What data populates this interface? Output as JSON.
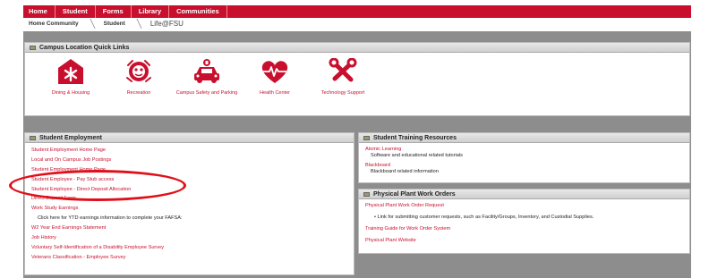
{
  "nav": {
    "items": [
      "Home",
      "Student",
      "Forms",
      "Library",
      "Communities"
    ]
  },
  "breadcrumb": {
    "items": [
      "Home Community",
      "Student"
    ],
    "current": "Life@FSU"
  },
  "quick_links": {
    "title": "Campus Location Quick Links",
    "items": [
      {
        "label": "Dining & Housing",
        "icon": "dining-housing-icon"
      },
      {
        "label": "Recreation",
        "icon": "recreation-icon"
      },
      {
        "label": "Campus Safety and Parking",
        "icon": "campus-safety-icon"
      },
      {
        "label": "Health Center",
        "icon": "health-center-icon"
      },
      {
        "label": "Technology Support",
        "icon": "technology-support-icon"
      }
    ]
  },
  "employment": {
    "title": "Student Employment",
    "items": [
      {
        "text": "Student Employment Home Page",
        "type": "link"
      },
      {
        "text": "Local and On Campus Job Postings",
        "type": "link"
      },
      {
        "text": "Student Employment Home Page",
        "type": "link"
      },
      {
        "text": "Student Employee - Pay Stub access",
        "type": "link"
      },
      {
        "text": "Student Employee - Direct Deposit Allocation",
        "type": "link"
      },
      {
        "text": "Direct Deposit Form",
        "type": "link"
      },
      {
        "text": "Work Study Earnings",
        "type": "link"
      },
      {
        "text": "Click here for YTD earnings information to complete your FAFSA:",
        "type": "text"
      },
      {
        "text": "W2 Year End Earnings Statement",
        "type": "link"
      },
      {
        "text": "Job History",
        "type": "link"
      },
      {
        "text": "Voluntary Self-Identification of a Disability Employee Survey",
        "type": "link"
      },
      {
        "text": "Veterans Classification - Employee Survey",
        "type": "link"
      }
    ]
  },
  "training": {
    "title": "Student Training Resources",
    "items": [
      {
        "link": "Atomic Learning",
        "desc": "Software and educational related tutorials"
      },
      {
        "link": "Blackboard",
        "desc": "Blackboard related information"
      }
    ]
  },
  "physical_plant": {
    "title": "Physical Plant Work Orders",
    "request_link": "Physical Plant Work Order Request",
    "bullet": "Link for submitting customer requests, such as Facility/Groups, Inventory, and Custodial Supplies.",
    "guide_link": "Training Guide for Work Order System",
    "website_link": "Physical Plant Website"
  },
  "colors": {
    "brand_red": "#c8102e",
    "background_gray": "#8d8d8d",
    "annotation_red": "#e0101a"
  }
}
